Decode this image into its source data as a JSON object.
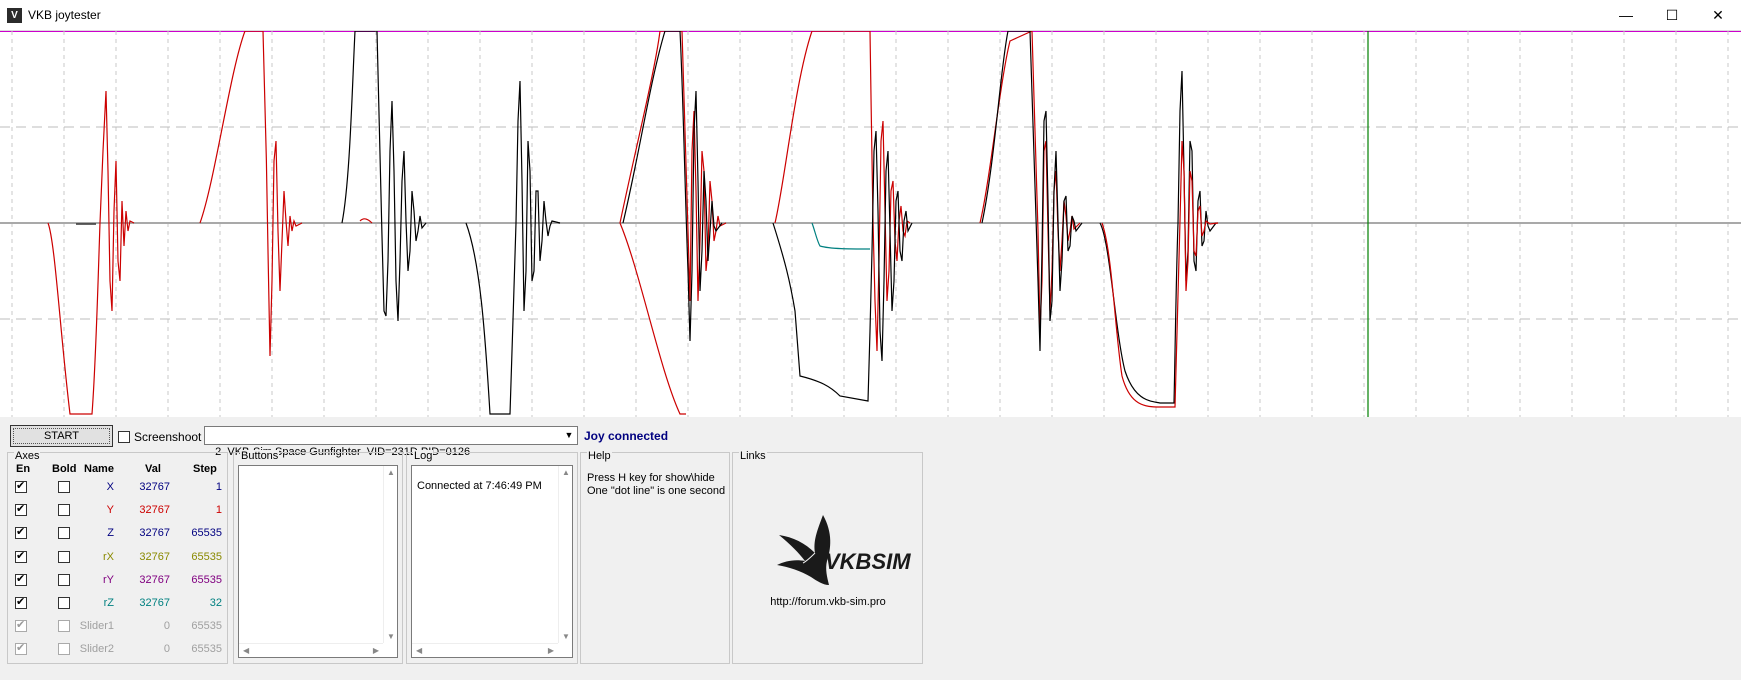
{
  "window": {
    "title": "VKB joytester",
    "icon": "vkb-app-icon",
    "minimize_glyph": "—",
    "maximize_glyph": "☐",
    "close_glyph": "✕"
  },
  "controls": {
    "start_label": "START",
    "screenshot_label": "Screenshoot",
    "screenshot_checked": false,
    "device_selected": "2  VKB-Sim Space Gunfighter  VID=231D PID=0126",
    "dropdown_arrow": "▼",
    "status": "Joy connected",
    "status_color": "#000080"
  },
  "axes": {
    "group_label": "Axes",
    "headers": {
      "en": "En",
      "bold": "Bold",
      "name": "Name",
      "val": "Val",
      "step": "Step"
    },
    "rows": [
      {
        "name": "X",
        "val": "32767",
        "step": "1",
        "enabled": true,
        "bold": false,
        "color": "#000080",
        "disabled": false
      },
      {
        "name": "Y",
        "val": "32767",
        "step": "1",
        "enabled": true,
        "bold": false,
        "color": "#cc0000",
        "disabled": false
      },
      {
        "name": "Z",
        "val": "32767",
        "step": "65535",
        "enabled": true,
        "bold": false,
        "color": "#000080",
        "disabled": false
      },
      {
        "name": "rX",
        "val": "32767",
        "step": "65535",
        "enabled": true,
        "bold": false,
        "color": "#8a8a00",
        "disabled": false
      },
      {
        "name": "rY",
        "val": "32767",
        "step": "65535",
        "enabled": true,
        "bold": false,
        "color": "#800080",
        "disabled": false
      },
      {
        "name": "rZ",
        "val": "32767",
        "step": "32",
        "enabled": true,
        "bold": false,
        "color": "#008080",
        "disabled": false
      },
      {
        "name": "Slider1",
        "val": "0",
        "step": "65535",
        "enabled": true,
        "bold": false,
        "color": "#a0a0a0",
        "disabled": true
      },
      {
        "name": "Slider2",
        "val": "0",
        "step": "65535",
        "enabled": true,
        "bold": false,
        "color": "#a0a0a0",
        "disabled": true
      }
    ]
  },
  "buttons_group": {
    "label": "Buttons"
  },
  "log_group": {
    "label": "Log",
    "lines": [
      "Connected at 7:46:49 PM"
    ]
  },
  "help_group": {
    "label": "Help",
    "lines": [
      "Press H key for show\\hide",
      "One \"dot line\" is one second"
    ]
  },
  "links_group": {
    "label": "Links",
    "logo_text": "VKBSIM",
    "url": "http://forum.vkb-sim.pro"
  },
  "plot": {
    "trace_colors": {
      "x": "#000000",
      "y": "#cc0000",
      "rz": "#008080",
      "marker": "#008000",
      "top_line": "#cc00cc"
    }
  }
}
